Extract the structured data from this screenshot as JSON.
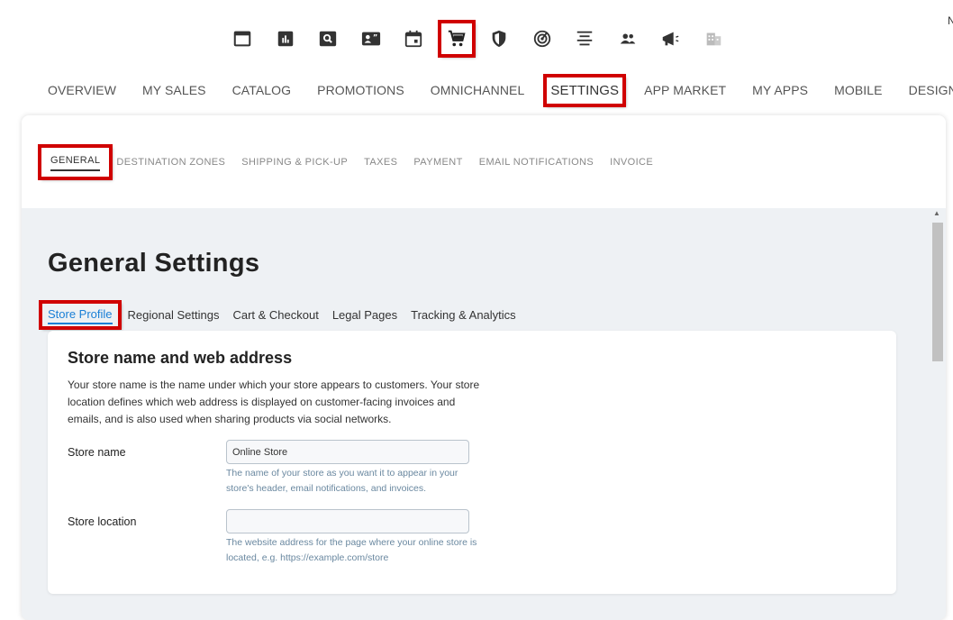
{
  "toolbar": {
    "icons": [
      {
        "name": "window-icon"
      },
      {
        "name": "analytics-icon"
      },
      {
        "name": "search-icon"
      },
      {
        "name": "contact-card-icon"
      },
      {
        "name": "calendar-icon"
      },
      {
        "name": "cart-icon",
        "highlighted": true
      },
      {
        "name": "shield-icon"
      },
      {
        "name": "target-icon"
      },
      {
        "name": "align-center-icon"
      },
      {
        "name": "people-icon"
      },
      {
        "name": "megaphone-icon"
      },
      {
        "name": "building-icon"
      }
    ],
    "corner_text": "N"
  },
  "main_nav": {
    "items": [
      {
        "label": "OVERVIEW"
      },
      {
        "label": "MY SALES"
      },
      {
        "label": "CATALOG"
      },
      {
        "label": "PROMOTIONS"
      },
      {
        "label": "OMNICHANNEL"
      },
      {
        "label": "SETTINGS",
        "active": true
      },
      {
        "label": "APP MARKET"
      },
      {
        "label": "MY APPS"
      },
      {
        "label": "MOBILE"
      },
      {
        "label": "DESIGN"
      }
    ]
  },
  "sub_nav": {
    "items": [
      {
        "label": "GENERAL",
        "active": true
      },
      {
        "label": "DESTINATION ZONES"
      },
      {
        "label": "SHIPPING & PICK-UP"
      },
      {
        "label": "TAXES"
      },
      {
        "label": "PAYMENT"
      },
      {
        "label": "EMAIL NOTIFICATIONS"
      },
      {
        "label": "INVOICE"
      }
    ]
  },
  "page": {
    "title": "General Settings",
    "tabs": [
      {
        "label": "Store Profile",
        "active": true
      },
      {
        "label": "Regional Settings"
      },
      {
        "label": "Cart & Checkout"
      },
      {
        "label": "Legal Pages"
      },
      {
        "label": "Tracking & Analytics"
      }
    ]
  },
  "card": {
    "title": "Store name and web address",
    "description": "Your store name is the name under which your store appears to customers. Your store location defines which web address is displayed on customer-facing invoices and emails, and is also used when sharing products via social networks.",
    "store_name": {
      "label": "Store name",
      "value": "Online Store",
      "help": "The name of your store as you want it to appear in your store's header, email notifications, and invoices."
    },
    "store_location": {
      "label": "Store location",
      "value": "",
      "help": "The website address for the page where your online store is located, e.g. https://example.com/store"
    }
  },
  "colors": {
    "highlight": "#d00000",
    "accent_blue": "#1a7fd6",
    "panel_bg": "#eef1f4"
  }
}
